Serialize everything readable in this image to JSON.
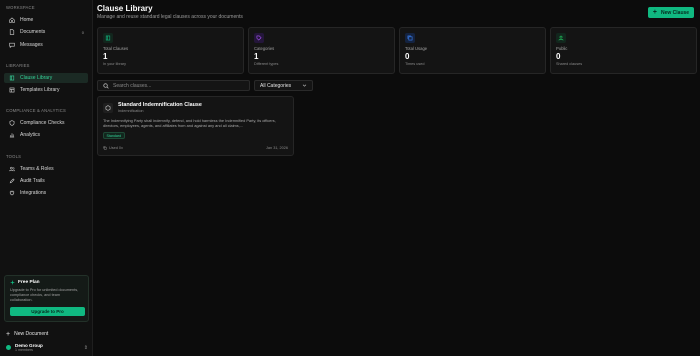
{
  "sidebar": {
    "sections": {
      "workspace": "WORKSPACE",
      "libraries": "LIBRARIES",
      "compliance": "COMPLIANCE & ANALYTICS",
      "tools": "TOOLS"
    },
    "items": {
      "home": "Home",
      "documents": "Documents",
      "documents_count": "0",
      "messages": "Messages",
      "clause_library": "Clause Library",
      "templates_library": "Templates Library",
      "compliance_checks": "Compliance Checks",
      "analytics": "Analytics",
      "teams_roles": "Teams & Roles",
      "audit_trails": "Audit Trails",
      "integrations": "Integrations"
    },
    "promo": {
      "title": "Free Plan",
      "text": "Upgrade to Pro for unlimited documents, compliance checks, and team collaboration.",
      "button": "Upgrade to Pro"
    },
    "new_document": "New Document",
    "org": {
      "name": "Demo Group",
      "members": "1 members"
    }
  },
  "header": {
    "title": "Clause Library",
    "subtitle": "Manage and reuse standard legal clauses across your documents",
    "new_button": "New Clause"
  },
  "stats": [
    {
      "label": "Total Clauses",
      "value": "1",
      "note": "In your library",
      "color": "#10b981",
      "icon": "book-icon"
    },
    {
      "label": "Categories",
      "value": "1",
      "note": "Different types",
      "color": "#a855f7",
      "icon": "tag-icon"
    },
    {
      "label": "Total Usage",
      "value": "0",
      "note": "Times used",
      "color": "#3b82f6",
      "icon": "copy-icon"
    },
    {
      "label": "Public",
      "value": "0",
      "note": "Shared clauses",
      "color": "#22c55e",
      "icon": "users-icon"
    }
  ],
  "search": {
    "placeholder": "Search clauses..."
  },
  "filter": {
    "selected": "All Categories"
  },
  "clauses": [
    {
      "title": "Standard Indemnification Clause",
      "category": "Indemnification",
      "body": "The Indemnifying Party shall indemnify, defend, and hold harmless the Indemnified Party, its officers, directors, employees, agents, and affiliates from and against any and all claims,...",
      "tag": "Standard",
      "usage": "Used 0x",
      "date": "Jan 31, 2026"
    }
  ]
}
